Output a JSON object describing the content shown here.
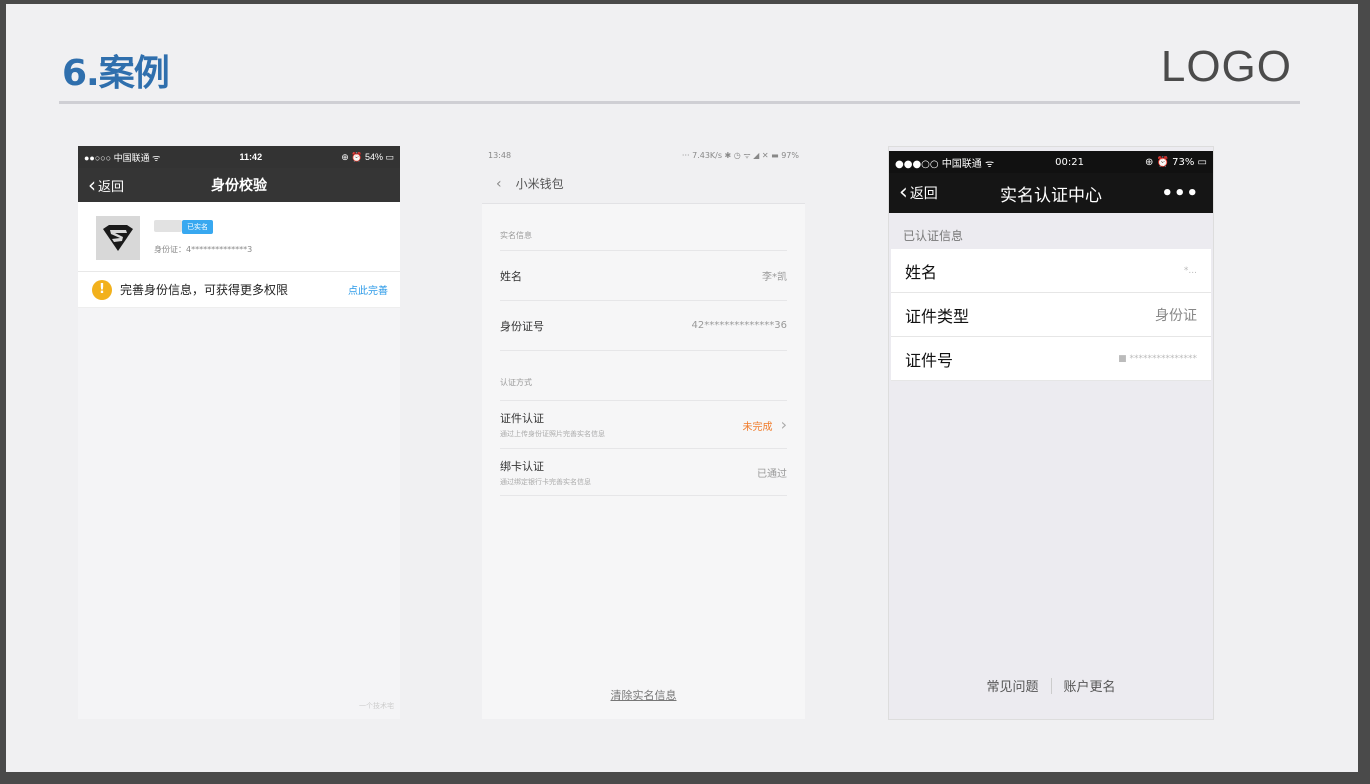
{
  "slide": {
    "title": "6.案例",
    "logo": "LOGO"
  },
  "phone1": {
    "status": {
      "carrier": "●●○○○ 中国联通 ᯤ",
      "time": "11:42",
      "battery": "⊕ ⏰ 54% ▭"
    },
    "nav": {
      "back_label": "返回",
      "title": "身份校验"
    },
    "card": {
      "badge": "已实名",
      "id_line": "身份证：4**************3"
    },
    "tip": {
      "message": "完善身份信息，可获得更多权限",
      "action": "点此完善"
    },
    "watermark": "一个技术宅"
  },
  "phone2": {
    "status": {
      "time": "13:48",
      "right": "··· 7.43K/s ✱ ◷ ᯤ ◢ ✕ ▬ 97%"
    },
    "nav": {
      "title": "小米钱包"
    },
    "section1": "实名信息",
    "rows": [
      {
        "label": "姓名",
        "value": "李*凯"
      },
      {
        "label": "身份证号",
        "value": "42**************36"
      }
    ],
    "section2": "认证方式",
    "methods": [
      {
        "label": "证件认证",
        "sub": "通过上传身份证照片完善实名信息",
        "value": "未完成"
      },
      {
        "label": "绑卡认证",
        "sub": "通过绑定银行卡完善实名信息",
        "value": "已通过"
      }
    ],
    "footer_link": "清除实名信息"
  },
  "phone3": {
    "status": {
      "carrier": "●●●○○ 中国联通 ᯤ",
      "time": "00:21",
      "battery": "⊕ ⏰ 73% ▭"
    },
    "nav": {
      "back_label": "返回",
      "title": "实名认证中心",
      "more": "•••"
    },
    "section": "已认证信息",
    "rows": [
      {
        "label": "姓名",
        "value": "*..."
      },
      {
        "label": "证件类型",
        "value": "身份证"
      },
      {
        "label": "证件号",
        "value": "■ ***************"
      }
    ],
    "footer": {
      "left": "常见问题",
      "right": "账户更名"
    }
  }
}
